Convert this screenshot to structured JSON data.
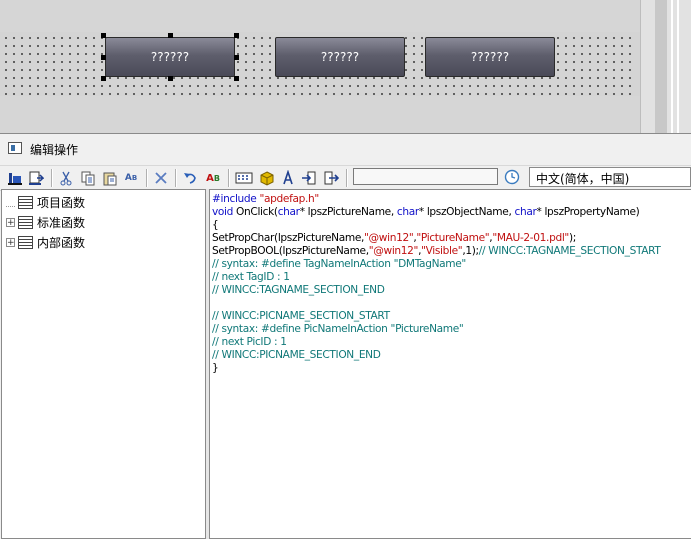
{
  "designer": {
    "buttons": [
      {
        "label": "??????",
        "selected": true
      },
      {
        "label": "??????",
        "selected": false
      },
      {
        "label": "??????",
        "selected": false
      }
    ]
  },
  "window": {
    "title": "编辑操作",
    "title_icon": "editor-window-icon"
  },
  "toolbar": {
    "icons": [
      "compile-icon",
      "export-icon",
      "cut-icon",
      "copy-icon",
      "paste-icon",
      "replace-icon",
      "delete-icon",
      "undo-icon",
      "spell-icon",
      "tag-icon",
      "object-icon",
      "function-icon",
      "import-icon",
      "export-arrow-icon"
    ],
    "input_value": "",
    "clock_icon": "clock-icon",
    "language": "中文(简体，中国)"
  },
  "tree": {
    "items": [
      {
        "label": "项目函数",
        "expandable": false
      },
      {
        "label": "标准函数",
        "expandable": true
      },
      {
        "label": "内部函数",
        "expandable": true
      }
    ]
  },
  "code": {
    "l1a": "#include ",
    "l1b": "\"apdefap.h\"",
    "l2a": "void",
    "l2b": " OnClick(",
    "l2c": "char",
    "l2d": "* lpszPictureName, ",
    "l2e": "char",
    "l2f": "* lpszObjectName, ",
    "l2g": "char",
    "l2h": "* lpszPropertyName)",
    "l3": "{",
    "l4a": "SetPropChar(lpszPictureName,",
    "l4b": "\"@win12\"",
    "l4c": ",",
    "l4d": "\"PictureName\"",
    "l4e": ",",
    "l4f": "\"MAU-2-01.pdl\"",
    "l4g": ");",
    "l5a": "SetPropBOOL(lpszPictureName,",
    "l5b": "\"@win12\"",
    "l5c": ",",
    "l5d": "\"Visible\"",
    "l5e": ",1);",
    "l5f": "// WINCC:TAGNAME_SECTION_START",
    "l6": "// syntax: #define TagNameInAction \"DMTagName\"",
    "l7": "// next TagID : 1",
    "l8": "// WINCC:TAGNAME_SECTION_END",
    "l10": "// WINCC:PICNAME_SECTION_START",
    "l11": "// syntax: #define PicNameInAction \"PictureName\"",
    "l12": "// next PicID : 1",
    "l13": "// WINCC:PICNAME_SECTION_END",
    "l14": "}"
  }
}
